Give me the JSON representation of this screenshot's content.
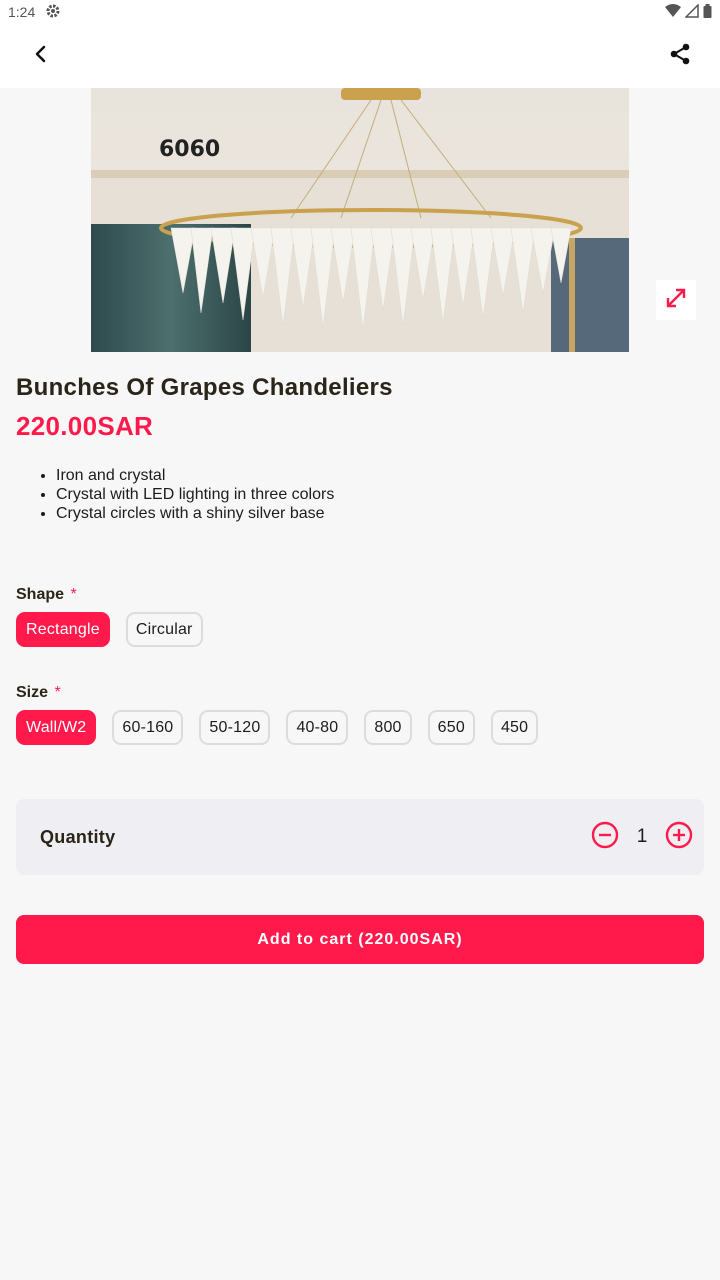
{
  "status_bar": {
    "time": "1:24"
  },
  "product": {
    "title": "Bunches Of Grapes Chandeliers",
    "price": "220.00SAR",
    "image_label": "6060",
    "features": [
      "Iron and crystal",
      "Crystal with LED lighting in three colors",
      "Crystal circles with a shiny silver base"
    ]
  },
  "options": {
    "shape": {
      "label": "Shape",
      "required_mark": "*",
      "choices": [
        "Rectangle",
        "Circular"
      ],
      "selected": "Rectangle"
    },
    "size": {
      "label": "Size",
      "required_mark": "*",
      "choices": [
        "Wall/W2",
        "60-160",
        "50-120",
        "40-80",
        "800",
        "650",
        "450"
      ],
      "selected": "Wall/W2"
    }
  },
  "quantity": {
    "label": "Quantity",
    "value": "1"
  },
  "cart_button": {
    "label": "Add to cart (220.00SAR)"
  },
  "colors": {
    "accent": "#ff1a4b",
    "background": "#f7f7f7",
    "quantity_bg": "#efeef2"
  },
  "icons": [
    "settings-gear-icon",
    "wifi-icon",
    "signal-icon",
    "battery-icon",
    "back-arrow-icon",
    "share-icon",
    "expand-icon",
    "minus-circle-icon",
    "plus-circle-icon"
  ]
}
